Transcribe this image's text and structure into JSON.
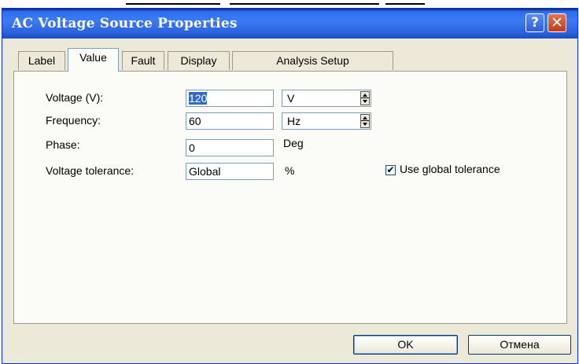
{
  "window": {
    "title": "AC Voltage Source Properties",
    "help_glyph": "?",
    "close_glyph": "✕"
  },
  "tabs": [
    {
      "label": "Label",
      "active": false
    },
    {
      "label": "Value",
      "active": true
    },
    {
      "label": "Fault",
      "active": false
    },
    {
      "label": "Display",
      "active": false
    },
    {
      "label": "Analysis Setup",
      "active": false
    }
  ],
  "form": {
    "voltage": {
      "label": "Voltage (V):",
      "value": "120",
      "unit": "V"
    },
    "frequency": {
      "label": "Frequency:",
      "value": "60",
      "unit": "Hz"
    },
    "phase": {
      "label": "Phase:",
      "value": "0",
      "unit": "Deg"
    },
    "tolerance": {
      "label": "Voltage tolerance:",
      "value": "Global",
      "unit": "%"
    },
    "use_global": {
      "label": "Use global tolerance",
      "checked": true,
      "glyph": "✔"
    }
  },
  "buttons": {
    "ok": "OK",
    "cancel": "Отмена"
  }
}
